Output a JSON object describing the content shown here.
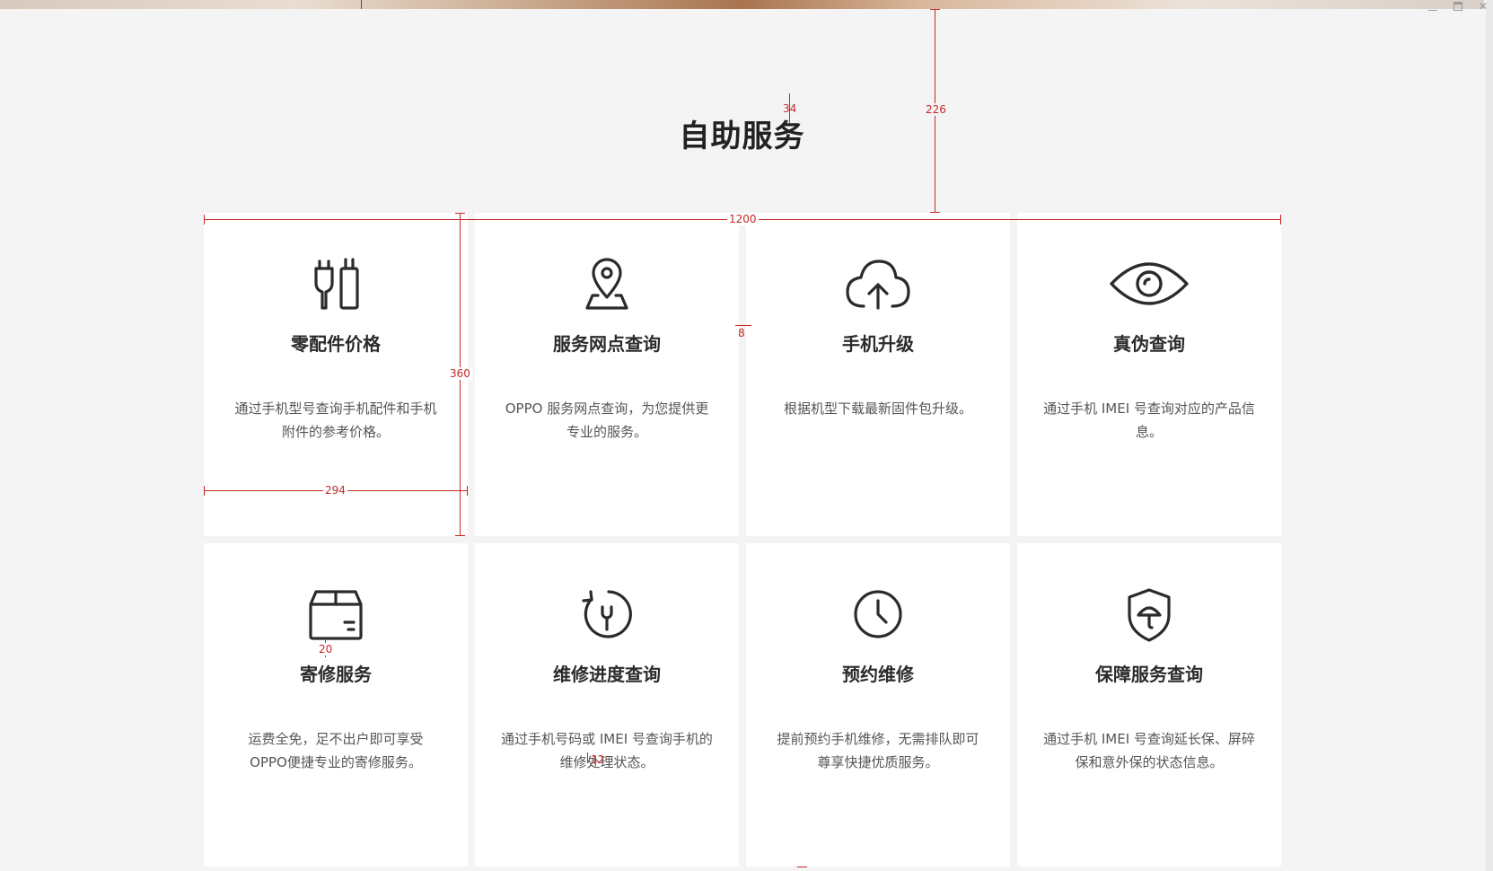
{
  "window": {
    "controls": [
      "minimize",
      "maximize",
      "close"
    ]
  },
  "section": {
    "title": "自助服务"
  },
  "cards": [
    {
      "id": "parts-price",
      "icon": "charger-cable-icon",
      "title": "零配件价格",
      "desc": "通过手机型号查询手机配件和手机附件的参考价格。"
    },
    {
      "id": "service-locator",
      "icon": "map-pin-icon",
      "title": "服务网点查询",
      "desc": "OPPO 服务网点查询，为您提供更专业的服务。"
    },
    {
      "id": "phone-upgrade",
      "icon": "cloud-upload-icon",
      "title": "手机升级",
      "desc": "根据机型下载最新固件包升级。"
    },
    {
      "id": "authenticity",
      "icon": "eye-icon",
      "title": "真伪查询",
      "desc": "通过手机 IMEI 号查询对应的产品信息。"
    },
    {
      "id": "mail-repair",
      "icon": "package-box-icon",
      "title": "寄修服务",
      "desc": "运费全免，足不出户即可享受OPPO便捷专业的寄修服务。"
    },
    {
      "id": "repair-progress",
      "icon": "wrench-refresh-icon",
      "title": "维修进度查询",
      "desc": "通过手机号码或 IMEI 号查询手机的维修处理状态。"
    },
    {
      "id": "book-repair",
      "icon": "clock-icon",
      "title": "预约维修",
      "desc": "提前预约手机维修，无需排队即可尊享快捷优质服务。"
    },
    {
      "id": "warranty",
      "icon": "shield-umbrella-icon",
      "title": "保障服务查询",
      "desc": "通过手机 IMEI 号查询延长保、屏碎保和意外保的状态信息。"
    }
  ],
  "annotations": {
    "title_to_grid": "226",
    "title_size": "34",
    "grid_width": "1200",
    "card_height": "360",
    "card_width": "294",
    "gap": "8",
    "icon_to_title": "20",
    "desc_gap": "12"
  }
}
